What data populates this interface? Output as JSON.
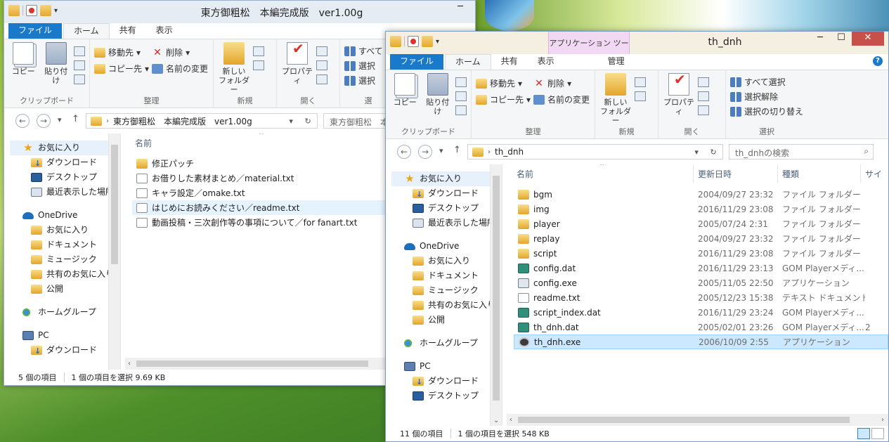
{
  "window1": {
    "title": "東方御粗松　本編完成版　ver1.00g",
    "tabs": [
      "ファイル",
      "ホーム",
      "共有",
      "表示"
    ],
    "ribbon": {
      "copy": "コピー",
      "paste": "貼り付け",
      "clipboard_group": "クリップボード",
      "move_to": "移動先",
      "copy_to": "コピー先",
      "delete": "削除",
      "rename": "名前の変更",
      "organize_group": "整理",
      "new_folder": "新しい\nフォルダー",
      "new_group": "新規",
      "properties": "プロパティ",
      "open_group": "開く",
      "select_all": "すべて",
      "select_none": "選択",
      "select_invert": "選択",
      "select_group": "選"
    },
    "address": "東方御粗松　本編完成版　ver1.00g",
    "search_placeholder": "東方御粗松　本",
    "nav": {
      "favorites": "お気に入り",
      "downloads": "ダウンロード",
      "desktop": "デスクトップ",
      "recent": "最近表示した場所",
      "onedrive": "OneDrive",
      "od_favorites": "お気に入り",
      "documents": "ドキュメント",
      "music": "ミュージック",
      "shared_favorites": "共有のお気に入り",
      "public": "公開",
      "homegroup": "ホームグループ",
      "pc": "PC",
      "pc_downloads": "ダウンロード"
    },
    "column_name": "名前",
    "files": [
      {
        "name": "修正パッチ",
        "icon": "folder-icon"
      },
      {
        "name": "お借りした素材まとめ／material.txt",
        "icon": "text-file-icon"
      },
      {
        "name": "キャラ設定／omake.txt",
        "icon": "text-file-icon"
      },
      {
        "name": "はじめにお読みください／readme.txt",
        "icon": "text-file-icon"
      },
      {
        "name": "動画投稿・三次創作等の事項について／for fanart.txt",
        "icon": "text-file-icon"
      }
    ],
    "status_count": "5 個の項目",
    "status_selected": "1 個の項目を選択  9.69 KB"
  },
  "window2": {
    "title": "th_dnh",
    "context_tab": "アプリケーション ツール",
    "tabs": [
      "ファイル",
      "ホーム",
      "共有",
      "表示"
    ],
    "manage_tab": "管理",
    "ribbon": {
      "copy": "コピー",
      "paste": "貼り付け",
      "clipboard_group": "クリップボード",
      "move_to": "移動先",
      "copy_to": "コピー先",
      "delete": "削除",
      "rename": "名前の変更",
      "organize_group": "整理",
      "new_folder": "新しい\nフォルダー",
      "new_group": "新規",
      "properties": "プロパティ",
      "open_group": "開く",
      "select_all": "すべて選択",
      "select_none": "選択解除",
      "select_invert": "選択の切り替え",
      "select_group": "選択"
    },
    "address": "th_dnh",
    "search_placeholder": "th_dnhの検索",
    "nav": {
      "favorites": "お気に入り",
      "downloads": "ダウンロード",
      "desktop": "デスクトップ",
      "recent": "最近表示した場所",
      "onedrive": "OneDrive",
      "od_favorites": "お気に入り",
      "documents": "ドキュメント",
      "music": "ミュージック",
      "shared_favorites": "共有のお気に入り",
      "public": "公開",
      "homegroup": "ホームグループ",
      "pc": "PC",
      "pc_downloads": "ダウンロード",
      "pc_desktop": "デスクトップ"
    },
    "columns": {
      "name": "名前",
      "date": "更新日時",
      "type": "種類",
      "size": "サイ"
    },
    "files": [
      {
        "name": "bgm",
        "date": "2004/09/27 23:32",
        "type": "ファイル フォルダー",
        "icon": "folder-icon",
        "size": ""
      },
      {
        "name": "img",
        "date": "2016/11/29 23:08",
        "type": "ファイル フォルダー",
        "icon": "folder-icon",
        "size": ""
      },
      {
        "name": "player",
        "date": "2005/07/24 2:31",
        "type": "ファイル フォルダー",
        "icon": "folder-icon",
        "size": ""
      },
      {
        "name": "replay",
        "date": "2004/09/27 23:32",
        "type": "ファイル フォルダー",
        "icon": "folder-icon",
        "size": ""
      },
      {
        "name": "script",
        "date": "2016/11/29 23:08",
        "type": "ファイル フォルダー",
        "icon": "folder-icon",
        "size": ""
      },
      {
        "name": "config.dat",
        "date": "2016/11/29 23:13",
        "type": "GOM Playerメディ...",
        "icon": "dat-file-icon",
        "size": ""
      },
      {
        "name": "config.exe",
        "date": "2005/11/05 22:50",
        "type": "アプリケーション",
        "icon": "exe-file-icon",
        "size": ""
      },
      {
        "name": "readme.txt",
        "date": "2005/12/23 15:38",
        "type": "テキスト ドキュメント",
        "icon": "text-file-icon",
        "size": ""
      },
      {
        "name": "script_index.dat",
        "date": "2016/11/29 23:24",
        "type": "GOM Playerメディ...",
        "icon": "dat-file-icon",
        "size": ""
      },
      {
        "name": "th_dnh.dat",
        "date": "2005/02/01 23:26",
        "type": "GOM Playerメディ...",
        "icon": "dat-file-icon",
        "size": "2"
      },
      {
        "name": "th_dnh.exe",
        "date": "2006/10/09 2:55",
        "type": "アプリケーション",
        "icon": "app-icon",
        "size": ""
      }
    ],
    "status_count": "11 個の項目",
    "status_selected": "1 個の項目を選択  548 KB"
  }
}
